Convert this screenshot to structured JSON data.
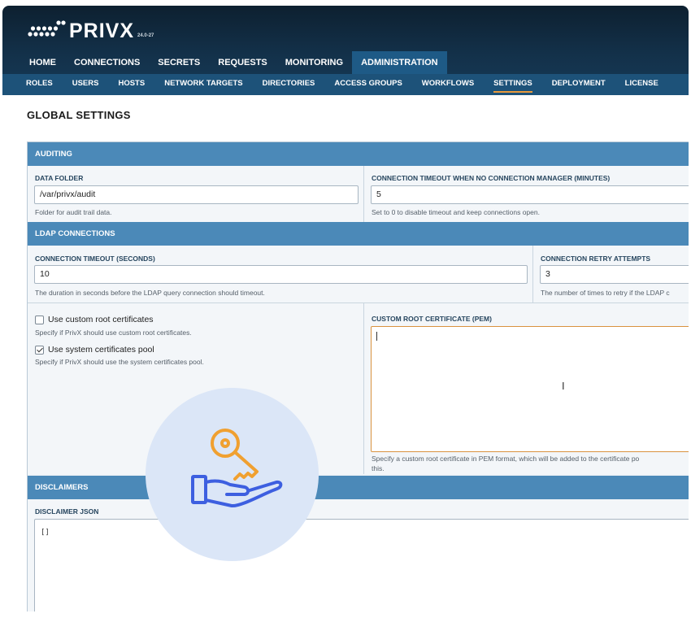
{
  "app": {
    "name": "PRIVX",
    "version": "24.0-27"
  },
  "main_nav": [
    {
      "label": "HOME",
      "active": false
    },
    {
      "label": "CONNECTIONS",
      "active": false
    },
    {
      "label": "SECRETS",
      "active": false
    },
    {
      "label": "REQUESTS",
      "active": false
    },
    {
      "label": "MONITORING",
      "active": false
    },
    {
      "label": "ADMINISTRATION",
      "active": true
    }
  ],
  "sub_nav": [
    {
      "label": "ROLES",
      "active": false
    },
    {
      "label": "USERS",
      "active": false
    },
    {
      "label": "HOSTS",
      "active": false
    },
    {
      "label": "NETWORK TARGETS",
      "active": false
    },
    {
      "label": "DIRECTORIES",
      "active": false
    },
    {
      "label": "ACCESS GROUPS",
      "active": false
    },
    {
      "label": "WORKFLOWS",
      "active": false
    },
    {
      "label": "SETTINGS",
      "active": true
    },
    {
      "label": "DEPLOYMENT",
      "active": false
    },
    {
      "label": "LICENSE",
      "active": false
    }
  ],
  "page_title": "GLOBAL SETTINGS",
  "auditing": {
    "title": "AUDITING",
    "data_folder": {
      "label": "DATA FOLDER",
      "value": "/var/privx/audit",
      "help": "Folder for audit trail data."
    },
    "connection_timeout": {
      "label": "CONNECTION TIMEOUT WHEN NO CONNECTION MANAGER (MINUTES)",
      "value": "5",
      "help": "Set to 0 to disable timeout and keep connections open."
    }
  },
  "ldap": {
    "title": "LDAP CONNECTIONS",
    "timeout": {
      "label": "CONNECTION TIMEOUT (SECONDS)",
      "value": "10",
      "help": "The duration in seconds before the LDAP query connection should timeout."
    },
    "retry": {
      "label": "CONNECTION RETRY ATTEMPTS",
      "value": "3",
      "help": "The number of times to retry if the LDAP c"
    },
    "custom_root": {
      "label": "Use custom root certificates",
      "checked": false,
      "help": "Specify if PrivX should use custom root certificates."
    },
    "system_pool": {
      "label": "Use system certificates pool",
      "checked": true,
      "help": "Specify if PrivX should use the system certificates pool."
    },
    "pem": {
      "label": "CUSTOM ROOT CERTIFICATE (PEM)",
      "value": "",
      "help_line1": "Specify a custom root certificate in PEM format, which will be added to the certificate po",
      "help_line2": "this."
    }
  },
  "disclaimers": {
    "title": "DISCLAIMERS",
    "json": {
      "label": "DISCLAIMER JSON",
      "value": "[]"
    }
  },
  "icons": {
    "logo": "privx-dots-logo-icon",
    "overlay": "key-in-hand-icon",
    "cursor": "text-cursor-icon"
  },
  "colors": {
    "header": "#13314a",
    "section": "#4b89b8",
    "accent": "#e99a3c",
    "focus": "#d9923f",
    "overlay_icon_key": "#f0a030",
    "overlay_icon_hand": "#3d5fe0"
  }
}
